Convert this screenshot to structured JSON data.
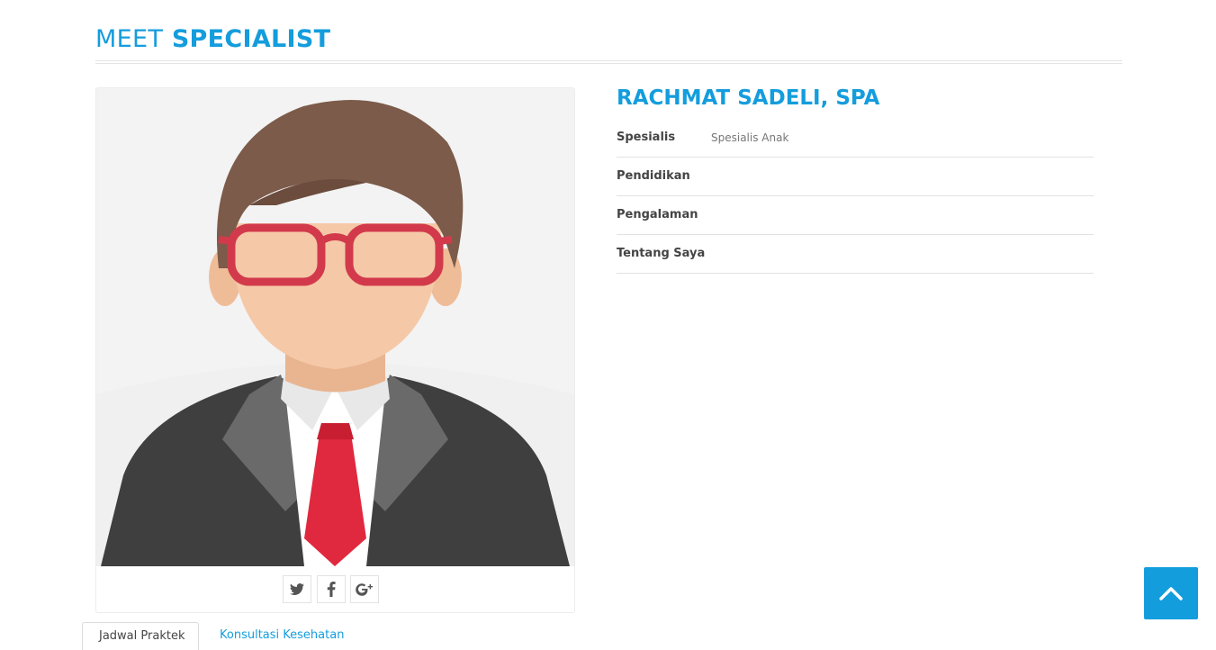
{
  "page": {
    "heading_light": "MEET",
    "heading_bold": "SPECIALIST"
  },
  "doctor": {
    "name": "RACHMAT SADELI, SPA",
    "details": [
      {
        "label": "Spesialis",
        "value": "Spesialis Anak"
      },
      {
        "label": "Pendidikan",
        "value": ""
      },
      {
        "label": "Pengalaman",
        "value": ""
      },
      {
        "label": "Tentang Saya",
        "value": ""
      }
    ]
  },
  "socials": [
    {
      "icon": "twitter-icon"
    },
    {
      "icon": "facebook-icon"
    },
    {
      "icon": "google-plus-icon"
    }
  ],
  "tabs": {
    "active_label": "Jadwal Praktek",
    "second_label": "Konsultasi Kesehatan"
  },
  "colors": {
    "accent": "#149ddd",
    "photo_bg": "#f3f3f3",
    "hair": "#7c5b4a",
    "skin": "#f5c9a8",
    "glasses": "#d23a4c",
    "suit": "#4a4a4a",
    "tie": "#e0283e"
  },
  "icons": {
    "back_to_top": "chevron-up-icon"
  }
}
